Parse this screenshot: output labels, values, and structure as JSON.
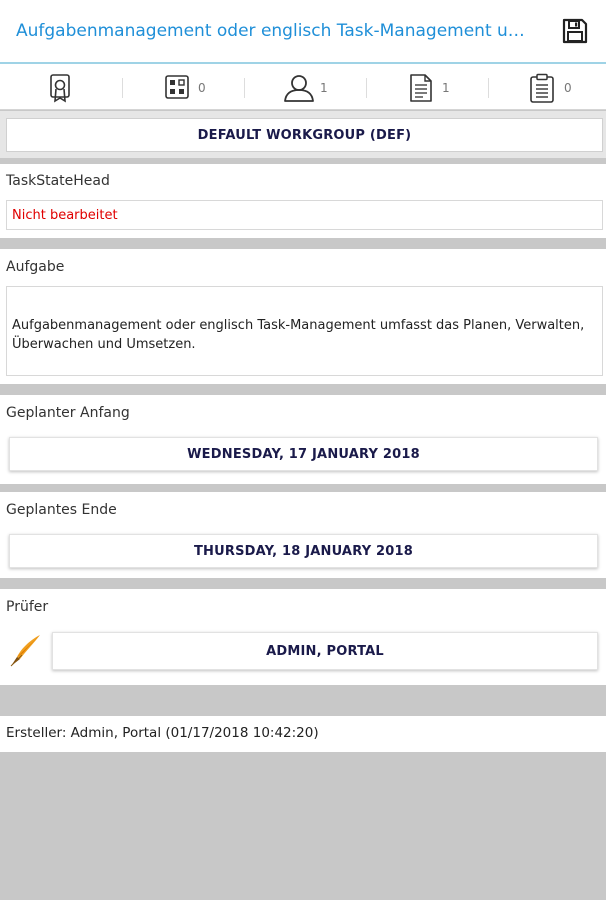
{
  "header": {
    "title": "Aufgabenmanagement oder englisch Task-Management umfasst das Planen, Verwalten, Überwachen und Umsetzen.",
    "save_icon": "floppy-disk-icon"
  },
  "tabs": [
    {
      "icon": "certificate-icon",
      "count": ""
    },
    {
      "icon": "grid-icon",
      "count": "0"
    },
    {
      "icon": "user-icon",
      "count": "1"
    },
    {
      "icon": "document-icon",
      "count": "1"
    },
    {
      "icon": "clipboard-icon",
      "count": "0"
    }
  ],
  "workgroup": {
    "label": "DEFAULT WORKGROUP (DEF)"
  },
  "state": {
    "heading": "TaskStateHead",
    "value": "Nicht bearbeitet",
    "color": "#e00000"
  },
  "task": {
    "heading": "Aufgabe",
    "text": "Aufgabenmanagement oder englisch Task-Management umfasst das Planen, Verwalten, Überwachen und Umsetzen."
  },
  "planned_start": {
    "heading": "Geplanter Anfang",
    "value": "WEDNESDAY, 17 JANUARY 2018"
  },
  "planned_end": {
    "heading": "Geplantes Ende",
    "value": "THURSDAY, 18 JANUARY 2018"
  },
  "reviewer": {
    "heading": "Prüfer",
    "value": "ADMIN, PORTAL",
    "icon": "quill-pen-icon"
  },
  "creator": {
    "text": "Ersteller: Admin, Portal (01/17/2018 10:42:20)"
  },
  "colors": {
    "accent": "#1f8fd8",
    "background": "#c8c8c8",
    "button_text": "#1a1a4a"
  }
}
